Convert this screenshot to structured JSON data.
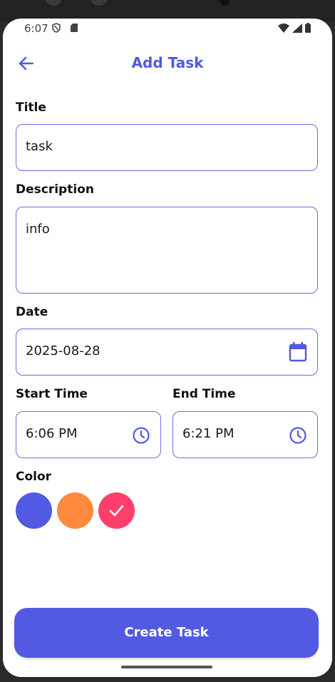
{
  "status_bar": {
    "time": "6:07"
  },
  "header": {
    "title": "Add Task"
  },
  "form": {
    "title": {
      "label": "Title",
      "value": "task"
    },
    "description": {
      "label": "Description",
      "value": "info"
    },
    "date": {
      "label": "Date",
      "value": "2025-08-28"
    },
    "start_time": {
      "label": "Start Time",
      "value": "6:06 PM"
    },
    "end_time": {
      "label": "End Time",
      "value": "6:21 PM"
    },
    "color": {
      "label": "Color",
      "options": [
        {
          "name": "blue",
          "hex": "#5259e2",
          "selected": false
        },
        {
          "name": "orange",
          "hex": "#ff8a3d",
          "selected": false
        },
        {
          "name": "pink",
          "hex": "#ff3f6a",
          "selected": true
        }
      ]
    }
  },
  "actions": {
    "create_label": "Create Task"
  },
  "theme": {
    "accent": "#5259e2",
    "border": "#6a6fdc"
  }
}
